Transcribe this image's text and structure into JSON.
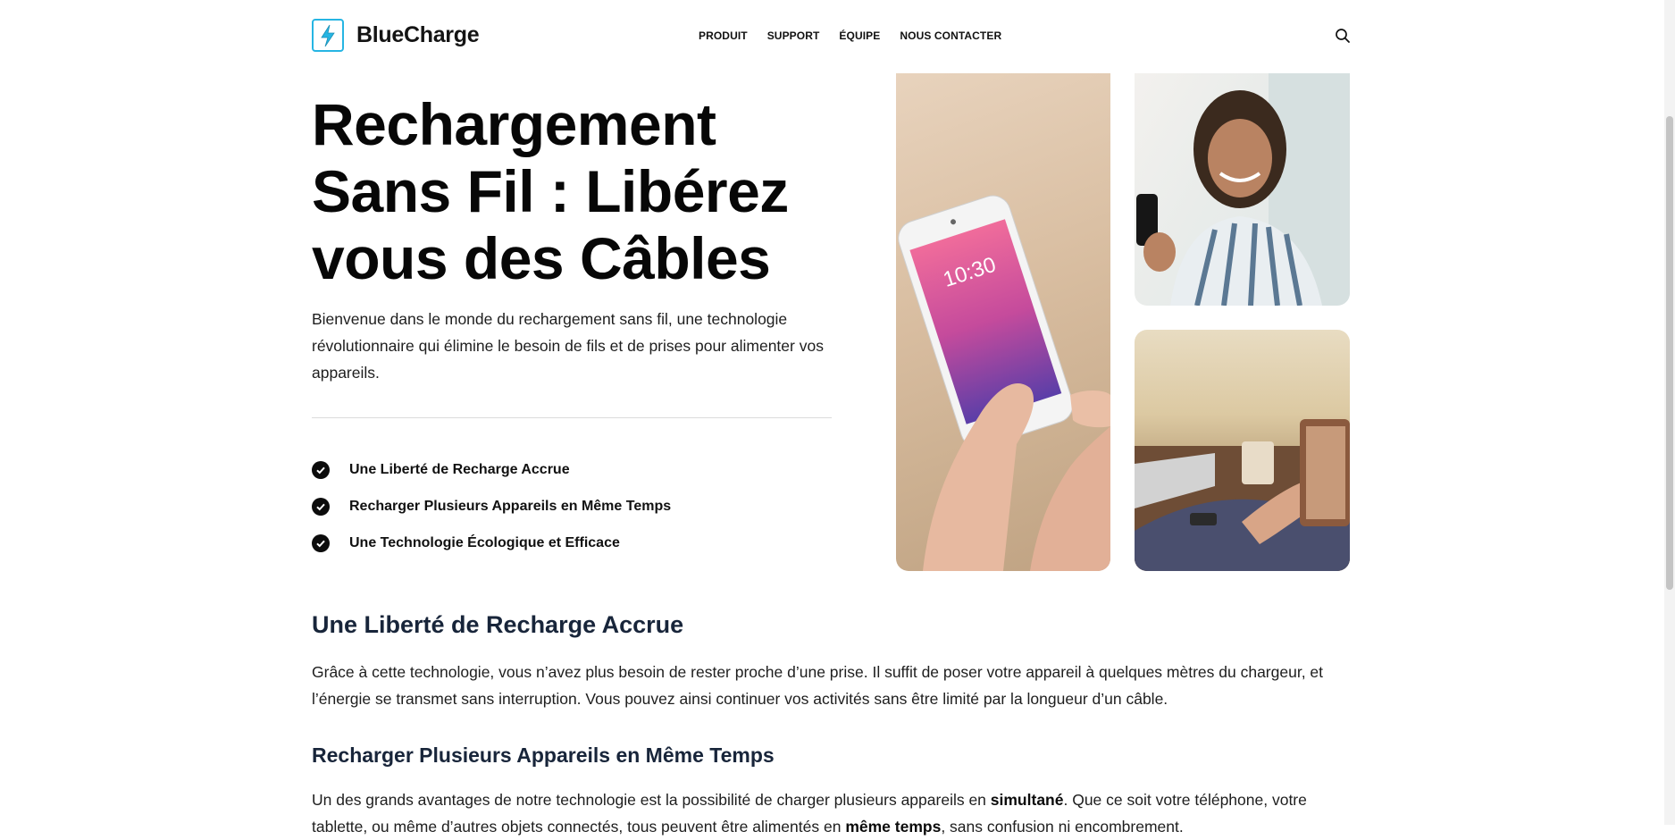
{
  "brand": {
    "name": "BlueCharge",
    "accent": "#26b5e3"
  },
  "nav": {
    "items": [
      "PRODUIT",
      "SUPPORT",
      "ÉQUIPE",
      "NOUS CONTACTER"
    ]
  },
  "hero": {
    "title": "Rechargement Sans Fil : Libérez vous des Câbles",
    "intro": "Bienvenue dans le monde du rechargement sans fil, une technologie révolutionnaire qui élimine le besoin de fils et de prises pour alimenter vos appareils.",
    "features": [
      "Une Liberté de Recharge Accrue",
      "Recharger Plusieurs Appareils en Même Temps",
      "Une Technologie Écologique et Efficace"
    ],
    "phone_time": "10:30"
  },
  "sections": {
    "freedom": {
      "title": "Une Liberté de Recharge Accrue",
      "text": "Grâce à cette technologie, vous n’avez plus besoin de rester proche d’une prise. Il suffit de poser votre appareil à quelques mètres du chargeur, et l’énergie se transmet sans interruption. Vous pouvez ainsi continuer vos activités sans être limité par la longueur d’un câble."
    },
    "multi": {
      "title": "Recharger Plusieurs Appareils en Même Temps",
      "text_a": "Un des grands avantages de notre technologie est la possibilité de charger plusieurs appareils en ",
      "text_b": "simultané",
      "text_c": ". Que ce soit votre téléphone, votre tablette, ou même d’autres objets connectés, tous peuvent être alimentés en ",
      "text_d": "même temps",
      "text_e": ", sans confusion ni encombrement."
    }
  }
}
